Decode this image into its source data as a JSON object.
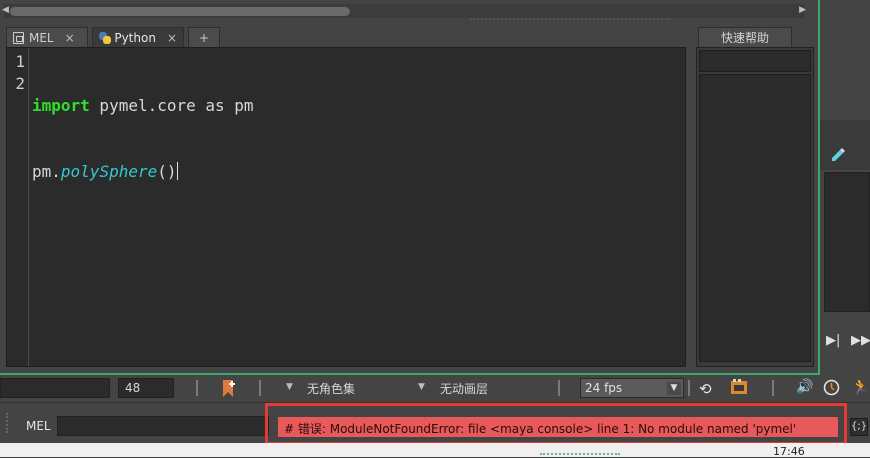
{
  "editor": {
    "tabs": [
      {
        "label": "MEL",
        "close": "×"
      },
      {
        "label": "Python",
        "close": "×"
      },
      {
        "label": "+"
      }
    ],
    "line_numbers": [
      "1",
      "2"
    ],
    "code": {
      "line1_keyword": "import",
      "line1_rest": " pymel.core as pm",
      "line2_obj": "pm.",
      "line2_fn": "polySphere",
      "line2_args": "()"
    }
  },
  "quick_help": {
    "title": "快速帮助"
  },
  "playback": {
    "range_value": "",
    "end_frame": "48",
    "character_set": "无角色集",
    "anim_layer": "无动画层",
    "fps": "24 fps"
  },
  "command_line": {
    "language": "MEL",
    "input_value": "",
    "error_message": "# 错误: ModuleNotFoundError: file <maya console> line 1: No module named 'pymel'",
    "script_editor_button": "{;}"
  },
  "taskbar": {
    "time": "17:46"
  },
  "colors": {
    "window_border": "#3aa869",
    "keyword": "#2ee02e",
    "function": "#32c9d0",
    "error_bg": "#e85a5a",
    "error_highlight": "#e53935"
  }
}
